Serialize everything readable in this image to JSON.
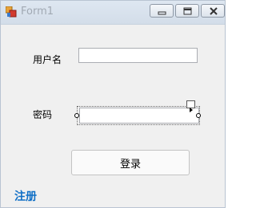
{
  "window": {
    "title": "Form1",
    "icon": "winforms-app-icon"
  },
  "caption_buttons": {
    "minimize_icon": "minimize-icon",
    "maximize_icon": "maximize-icon",
    "close_icon": "close-icon"
  },
  "form": {
    "username_label": "用户名",
    "username_value": "",
    "password_label": "密码",
    "password_value": "",
    "login_button": "登录",
    "register_link": "注册"
  },
  "colors": {
    "link": "#0f6fc6",
    "form_background": "#f0f0f0"
  }
}
